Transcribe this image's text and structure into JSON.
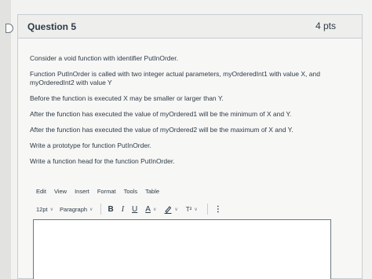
{
  "question": {
    "title": "Question 5",
    "points": "4 pts"
  },
  "body": {
    "paragraphs": [
      "Consider a void function with identifier PutInOrder.",
      "Function PutInOrder is called with two integer actual parameters, myOrderedInt1 with value X, and myOrderedInt2 with value Y",
      "Before the function is executed X may be smaller or larger than Y.",
      "After the function has executed the value of myOrdered1 will be the minimum of X and Y.",
      "After the function has executed the value of myOrdered2 will be the maximum of X and Y.",
      "Write a prototype for function PutInOrder.",
      "Write a function head for the function PutInOrder."
    ]
  },
  "editor": {
    "menu": [
      "Edit",
      "View",
      "Insert",
      "Format",
      "Tools",
      "Table"
    ],
    "font_size": "12pt",
    "block_format": "Paragraph",
    "bold_label": "B",
    "italic_label": "I",
    "underline_label": "U",
    "font_color_label": "A",
    "superscript_label": "T²",
    "more_label": "⋮",
    "value": ""
  },
  "icons": {
    "flag": "flag-icon",
    "highlight": "highlight-pen-icon"
  }
}
